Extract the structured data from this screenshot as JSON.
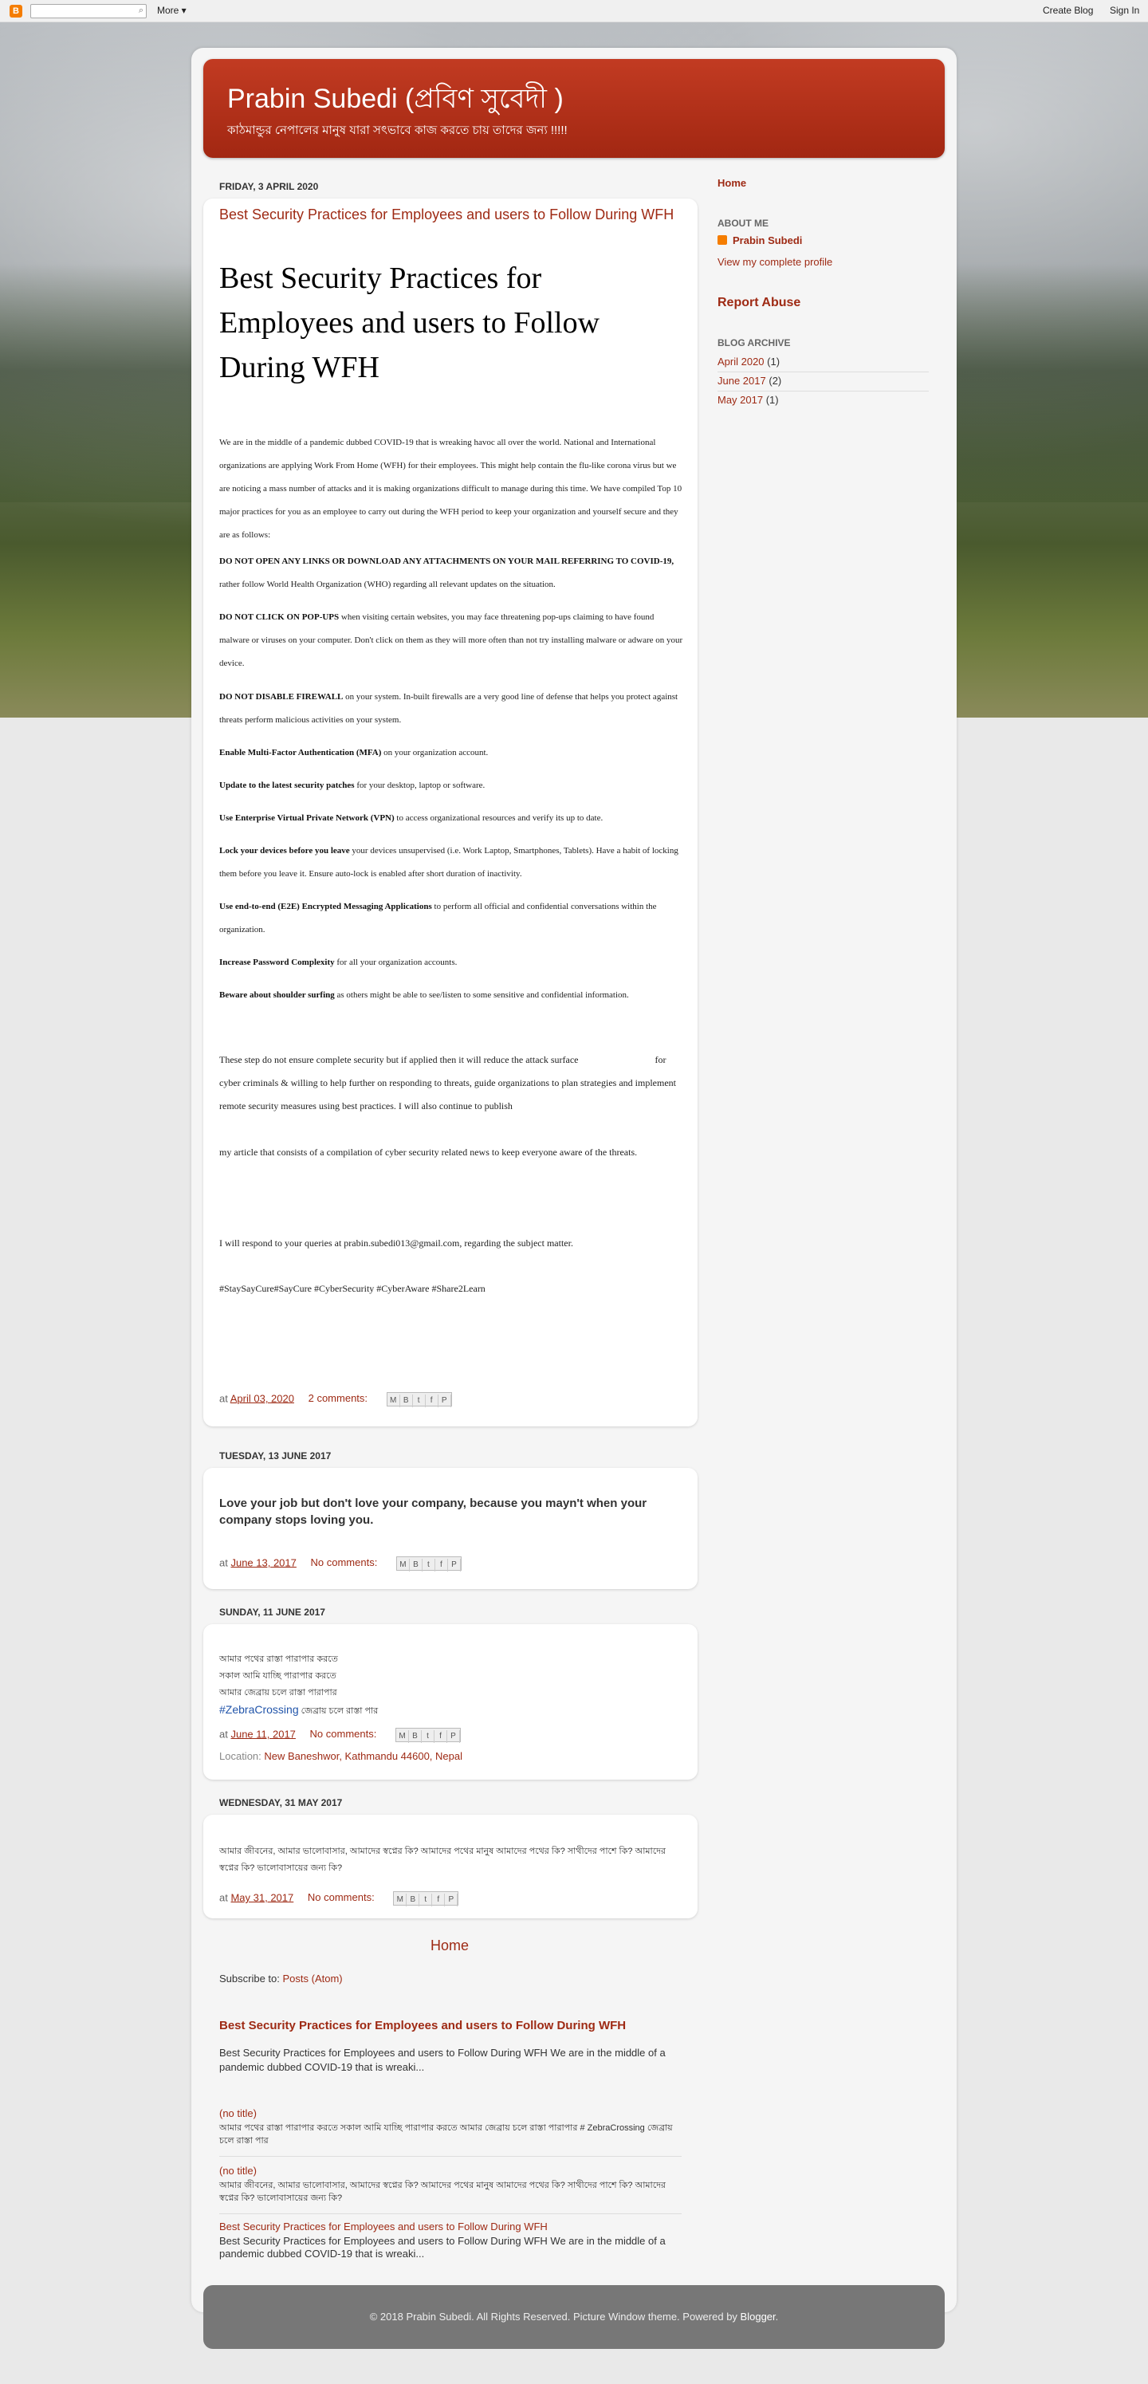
{
  "navbar": {
    "more": "More ▾",
    "create_blog": "Create Blog",
    "sign_in": "Sign In"
  },
  "header": {
    "title": "Prabin Subedi (প্রবিণ সুবেদী )",
    "description": "কাঠমান্ডুর নেপালের মানুষ যারা সৎভাবে কাজ করতে চায় তাদের জন্য !!!!!"
  },
  "posts": [
    {
      "date": "Friday, 3 April 2020",
      "link_title": "Best Security Practices for Employees and users to Follow During WFH",
      "heading": "Best Security Practices for Employees and users to Follow During WFH",
      "intro": "We are in the middle of a pandemic dubbed COVID-19 that is wreaking havoc all over the world. National and International organizations are applying Work From Home (WFH) for their employees. This might help contain the flu-like corona virus but we are noticing a mass number of attacks and it is making organizations difficult to manage during this time. We have compiled Top 10 major practices for you as an employee to carry out during the WFH period to keep your organization and yourself secure and they are as follows:",
      "tips": [
        {
          "bold": "DO NOT OPEN ANY LINKS OR DOWNLOAD ANY ATTACHMENTS ON YOUR MAIL REFERRING TO COVID-19,",
          "text": " rather follow World Health Organization (WHO) regarding all relevant updates on the situation."
        },
        {
          "bold": "DO NOT CLICK ON POP-UPS",
          "text": " when visiting certain websites, you may face threatening pop-ups claiming to have found malware or viruses on your computer. Don't click on them as they will more often than not try installing malware or adware on your device."
        },
        {
          "bold": "DO NOT DISABLE FIREWALL",
          "text": " on your system. In-built firewalls are a very good line of defense that helps you protect against threats perform malicious activities on your system."
        },
        {
          "bold": "Enable Multi-Factor Authentication (MFA)",
          "text": " on your organization account."
        },
        {
          "bold": "Update to the latest security patches",
          "text": " for your desktop, laptop or software."
        },
        {
          "bold": "Use Enterprise Virtual Private Network (VPN)",
          "text": " to access organizational resources and verify its up to date."
        },
        {
          "bold": "Lock your devices before you leave",
          "text": " your devices unsupervised (i.e. Work Laptop, Smartphones, Tablets). Have a habit of locking them before you leave it. Ensure auto-lock is enabled after short duration of inactivity."
        },
        {
          "bold": "Use end-to-end (E2E) Encrypted Messaging Applications",
          "text": " to perform all official and confidential conversations within the organization."
        },
        {
          "bold": "Increase Password Complexity",
          "text": " for all your organization accounts."
        },
        {
          "bold": "Beware about shoulder surfing",
          "text": " as others might be able to see/listen to some sensitive and confidential information."
        }
      ],
      "para1": "These step do not ensure complete security but if applied then it will reduce the attack surface                                for cyber criminals & willing to help further on responding to threats, guide organizations to plan strategies and implement remote security measures using best practices. I will also continue to publish",
      "para2": "my article that consists of a compilation of cyber security related news to keep everyone aware of the threats.",
      "para3": "I will respond to your queries at prabin.subedi013@gmail.com, regarding the subject matter.",
      "para4": "#StaySayCure#SayCure #CyberSecurity #CyberAware #Share2Learn",
      "at": "at",
      "time": "April 03, 2020",
      "comments": "2 comments:"
    },
    {
      "date": "Tuesday, 13 June 2017",
      "body": "Love your job but don't love your company, because you mayn't when your company stops loving you.",
      "at": "at",
      "time": "June 13, 2017",
      "comments": "No comments:"
    },
    {
      "date": "Sunday, 11 June 2017",
      "lines": [
        "আমার পথের রাস্তা পারাপার করতে",
        "সকাল আমি যাচ্ছি পারাপার করতে",
        "আমার জেব্রায় চলে রাস্তা পারাপার"
      ],
      "hashtag": "#ZebraCrossing",
      "hashtag_rest": " জেব্রায় চলে রাস্তা পার",
      "at": "at",
      "time": "June 11, 2017",
      "comments": "No comments:",
      "location_label": "Location:",
      "location": "New Baneshwor, Kathmandu 44600, Nepal"
    },
    {
      "date": "Wednesday, 31 May 2017",
      "body": "আমার জীবনের, আমার ভালোবাসার, আমাদের স্বপ্নের কি? আমাদের পথের মানুষ আমাদের পথের কি? সাথীদের পাশে কি? আমাদের স্বপ্নের কি? ভালোবাসায়ের জন্য কি?",
      "at": "at",
      "time": "May 31, 2017",
      "comments": "No comments:"
    }
  ],
  "home_link": "Home",
  "subscribe": {
    "label": "Subscribe to:",
    "link": "Posts (Atom)"
  },
  "featured": {
    "title": "Best Security Practices for Employees and users to Follow During WFH",
    "snippet": "Best Security Practices for Employees and users to Follow During WFH We are in the middle of a pandemic dubbed COVID-19 that is wreaki..."
  },
  "popular": [
    {
      "title": "(no title)",
      "snippet": "আমার পথের রাস্তা পারাপার করতে  সকাল আমি যাচ্ছি পারাপার করতে  আমার জেব্রায় চলে রাস্তা পারাপার  # ZebraCrossing  জেব্রায় চলে রাস্তা পার"
    },
    {
      "title": "(no title)",
      "snippet": "আমার জীবনের, আমার ভালোবাসার, আমাদের স্বপ্নের কি? আমাদের পথের মানুষ আমাদের পথের কি? সাথীদের পাশে কি? আমাদের স্বপ্নের কি? ভালোবাসায়ের জন্য কি?"
    },
    {
      "title": "Best Security Practices for Employees and users to Follow During WFH",
      "snippet": "Best Security Practices for Employees and users to Follow During WFH We are in the middle of a pandemic dubbed COVID-19 that is wreaki..."
    }
  ],
  "sidebar": {
    "home": "Home",
    "about_title": "About Me",
    "profile_name": "Prabin Subedi",
    "view_profile": "View my complete profile",
    "report_abuse": "Report Abuse",
    "archive_title": "Blog Archive",
    "archive": [
      {
        "label": "April 2020",
        "count": "(1)"
      },
      {
        "label": "June 2017",
        "count": "(2)"
      },
      {
        "label": "May 2017",
        "count": "(1)"
      }
    ]
  },
  "footer": {
    "text": "© 2018 Prabin Subedi. All Rights Reserved. Picture Window theme. Powered by ",
    "link": "Blogger",
    "end": "."
  }
}
